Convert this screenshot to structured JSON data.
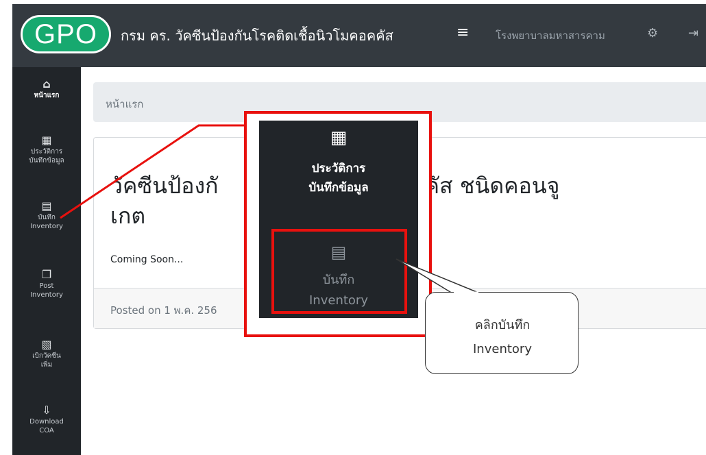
{
  "header": {
    "logo": "GPO",
    "title": "กรม คร. วัคซีนป้องกันโรคติดเชื้อนิวโมคอคคัส",
    "menu_icon": "≡",
    "hospital": "โรงพยาบาลมหาสารคาม",
    "icons": [
      "gear-icon",
      "sign-out-icon"
    ]
  },
  "sidebar": {
    "items": [
      {
        "icon": "home-icon",
        "label": "หน้าแรก"
      },
      {
        "icon": "calendar-icon",
        "label_1": "ประวัติการ",
        "label_2": "บันทึกข้อมูล"
      },
      {
        "icon": "clipboard-list-icon",
        "label_1": "บันทึก",
        "label_2": "Inventory"
      },
      {
        "icon": "copy-icon",
        "label_1": "Post",
        "label_2": "Inventory"
      },
      {
        "icon": "file-pdf-icon",
        "label_1": "เบิกวัคซีน",
        "label_2": "เพิ่ม"
      },
      {
        "icon": "file-download-icon",
        "label_1": "Download",
        "label_2": "COA"
      }
    ]
  },
  "breadcrumb": "หน้าแรก",
  "card": {
    "title_line1": "วัคซีนป้องกั",
    "title_line1_end": "มคอคคัส ชนิดคอนจู",
    "title_line2": "เกต",
    "text": "Coming Soon...",
    "footer": "Posted on 1 พ.ค. 256"
  },
  "zoom": {
    "history_label_1": "ประวัติการ",
    "history_label_2": "บันทึกข้อมูล",
    "inventory_label_1": "บันทึก",
    "inventory_label_2": "Inventory"
  },
  "callout": {
    "line1": "คลิกบันทึก",
    "line2": "Inventory"
  },
  "colors": {
    "topbar": "#343a40",
    "sidebar": "#212529",
    "logo": "#17a96f",
    "highlight": "#e8110e"
  }
}
